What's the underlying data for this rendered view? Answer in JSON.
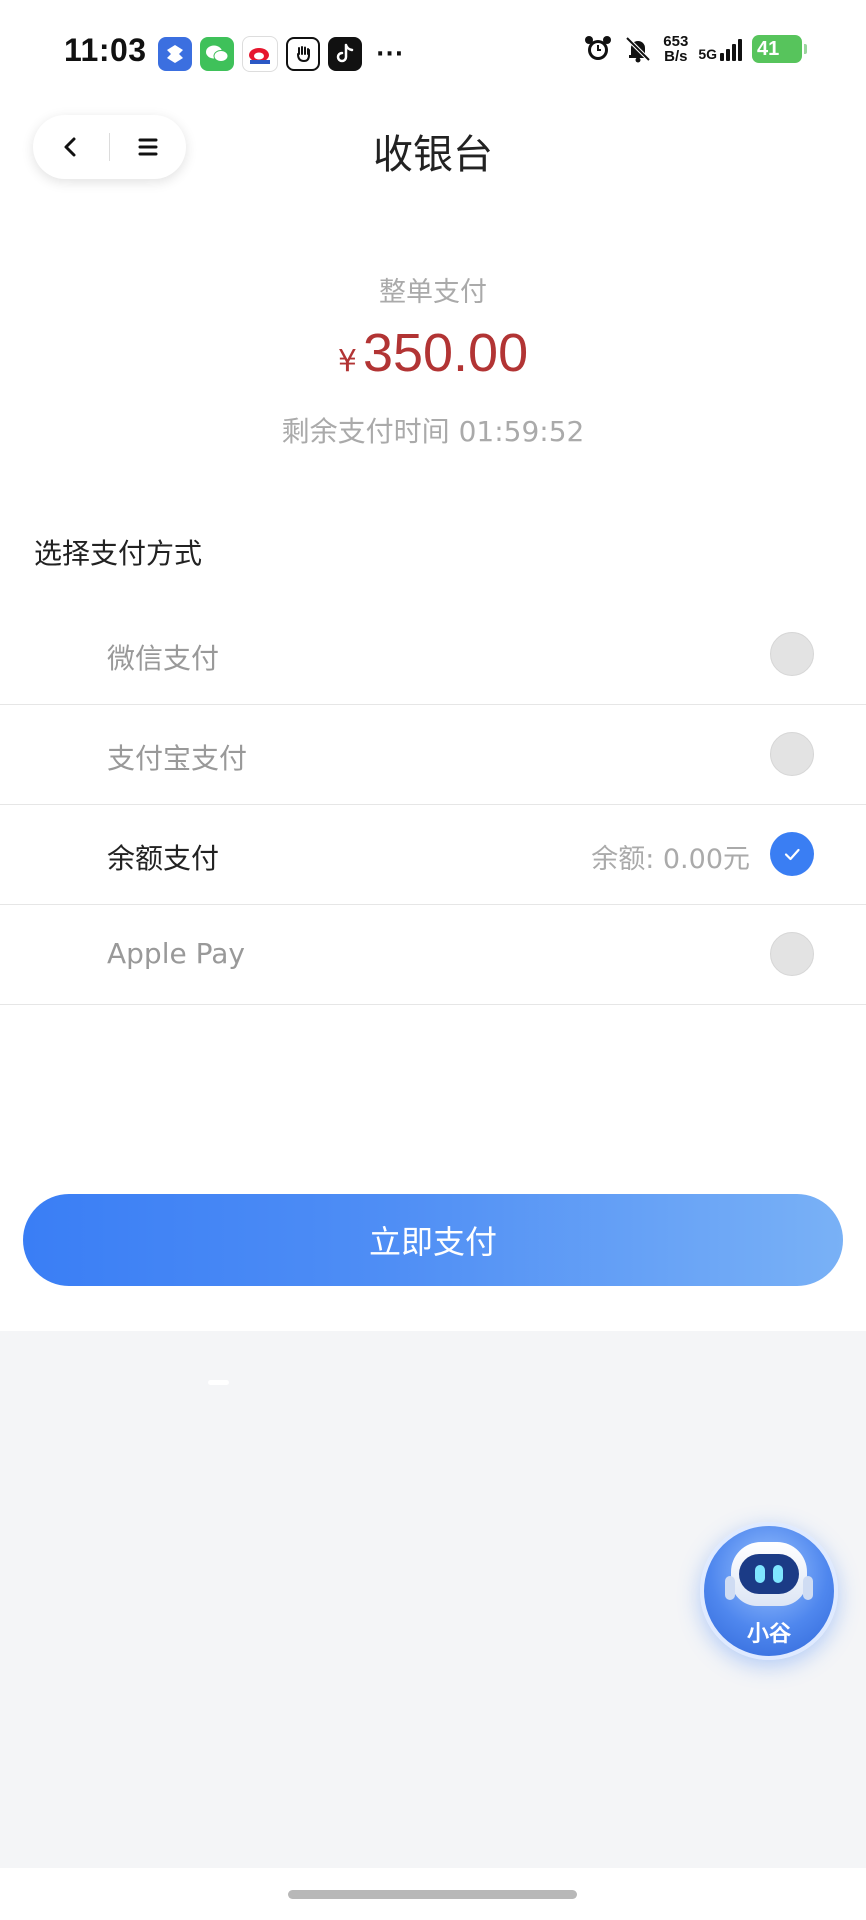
{
  "status_bar": {
    "time": "11:03",
    "more": "···",
    "speed_value": "653",
    "speed_unit": "B/s",
    "network": "5G",
    "battery": "41",
    "app_icons": [
      "app-icon-blue",
      "wechat-icon",
      "sina-icon",
      "hand-icon",
      "tiktok-icon"
    ],
    "status_icons": [
      "alarm-icon",
      "bell-off-icon",
      "signal-icon",
      "battery-icon"
    ]
  },
  "header": {
    "title": "收银台",
    "back_icon": "chevron-left-icon",
    "menu_icon": "menu-icon"
  },
  "summary": {
    "label": "整单支付",
    "currency": "¥",
    "amount": "350.00",
    "countdown": "剩余支付时间 01:59:52"
  },
  "payment": {
    "section_title": "选择支付方式",
    "methods": [
      {
        "label": "微信支付",
        "extra": "",
        "selected": false
      },
      {
        "label": "支付宝支付",
        "extra": "",
        "selected": false
      },
      {
        "label": "余额支付",
        "extra": "余额: 0.00元",
        "selected": true
      },
      {
        "label": "Apple Pay",
        "extra": "",
        "selected": false
      }
    ]
  },
  "actions": {
    "pay_label": "立即支付"
  },
  "assistant": {
    "label": "小谷",
    "icon": "robot-icon"
  },
  "colors": {
    "amount": "#b23434",
    "accent": "#3a7ef3",
    "background_lower": "#f4f5f7"
  }
}
